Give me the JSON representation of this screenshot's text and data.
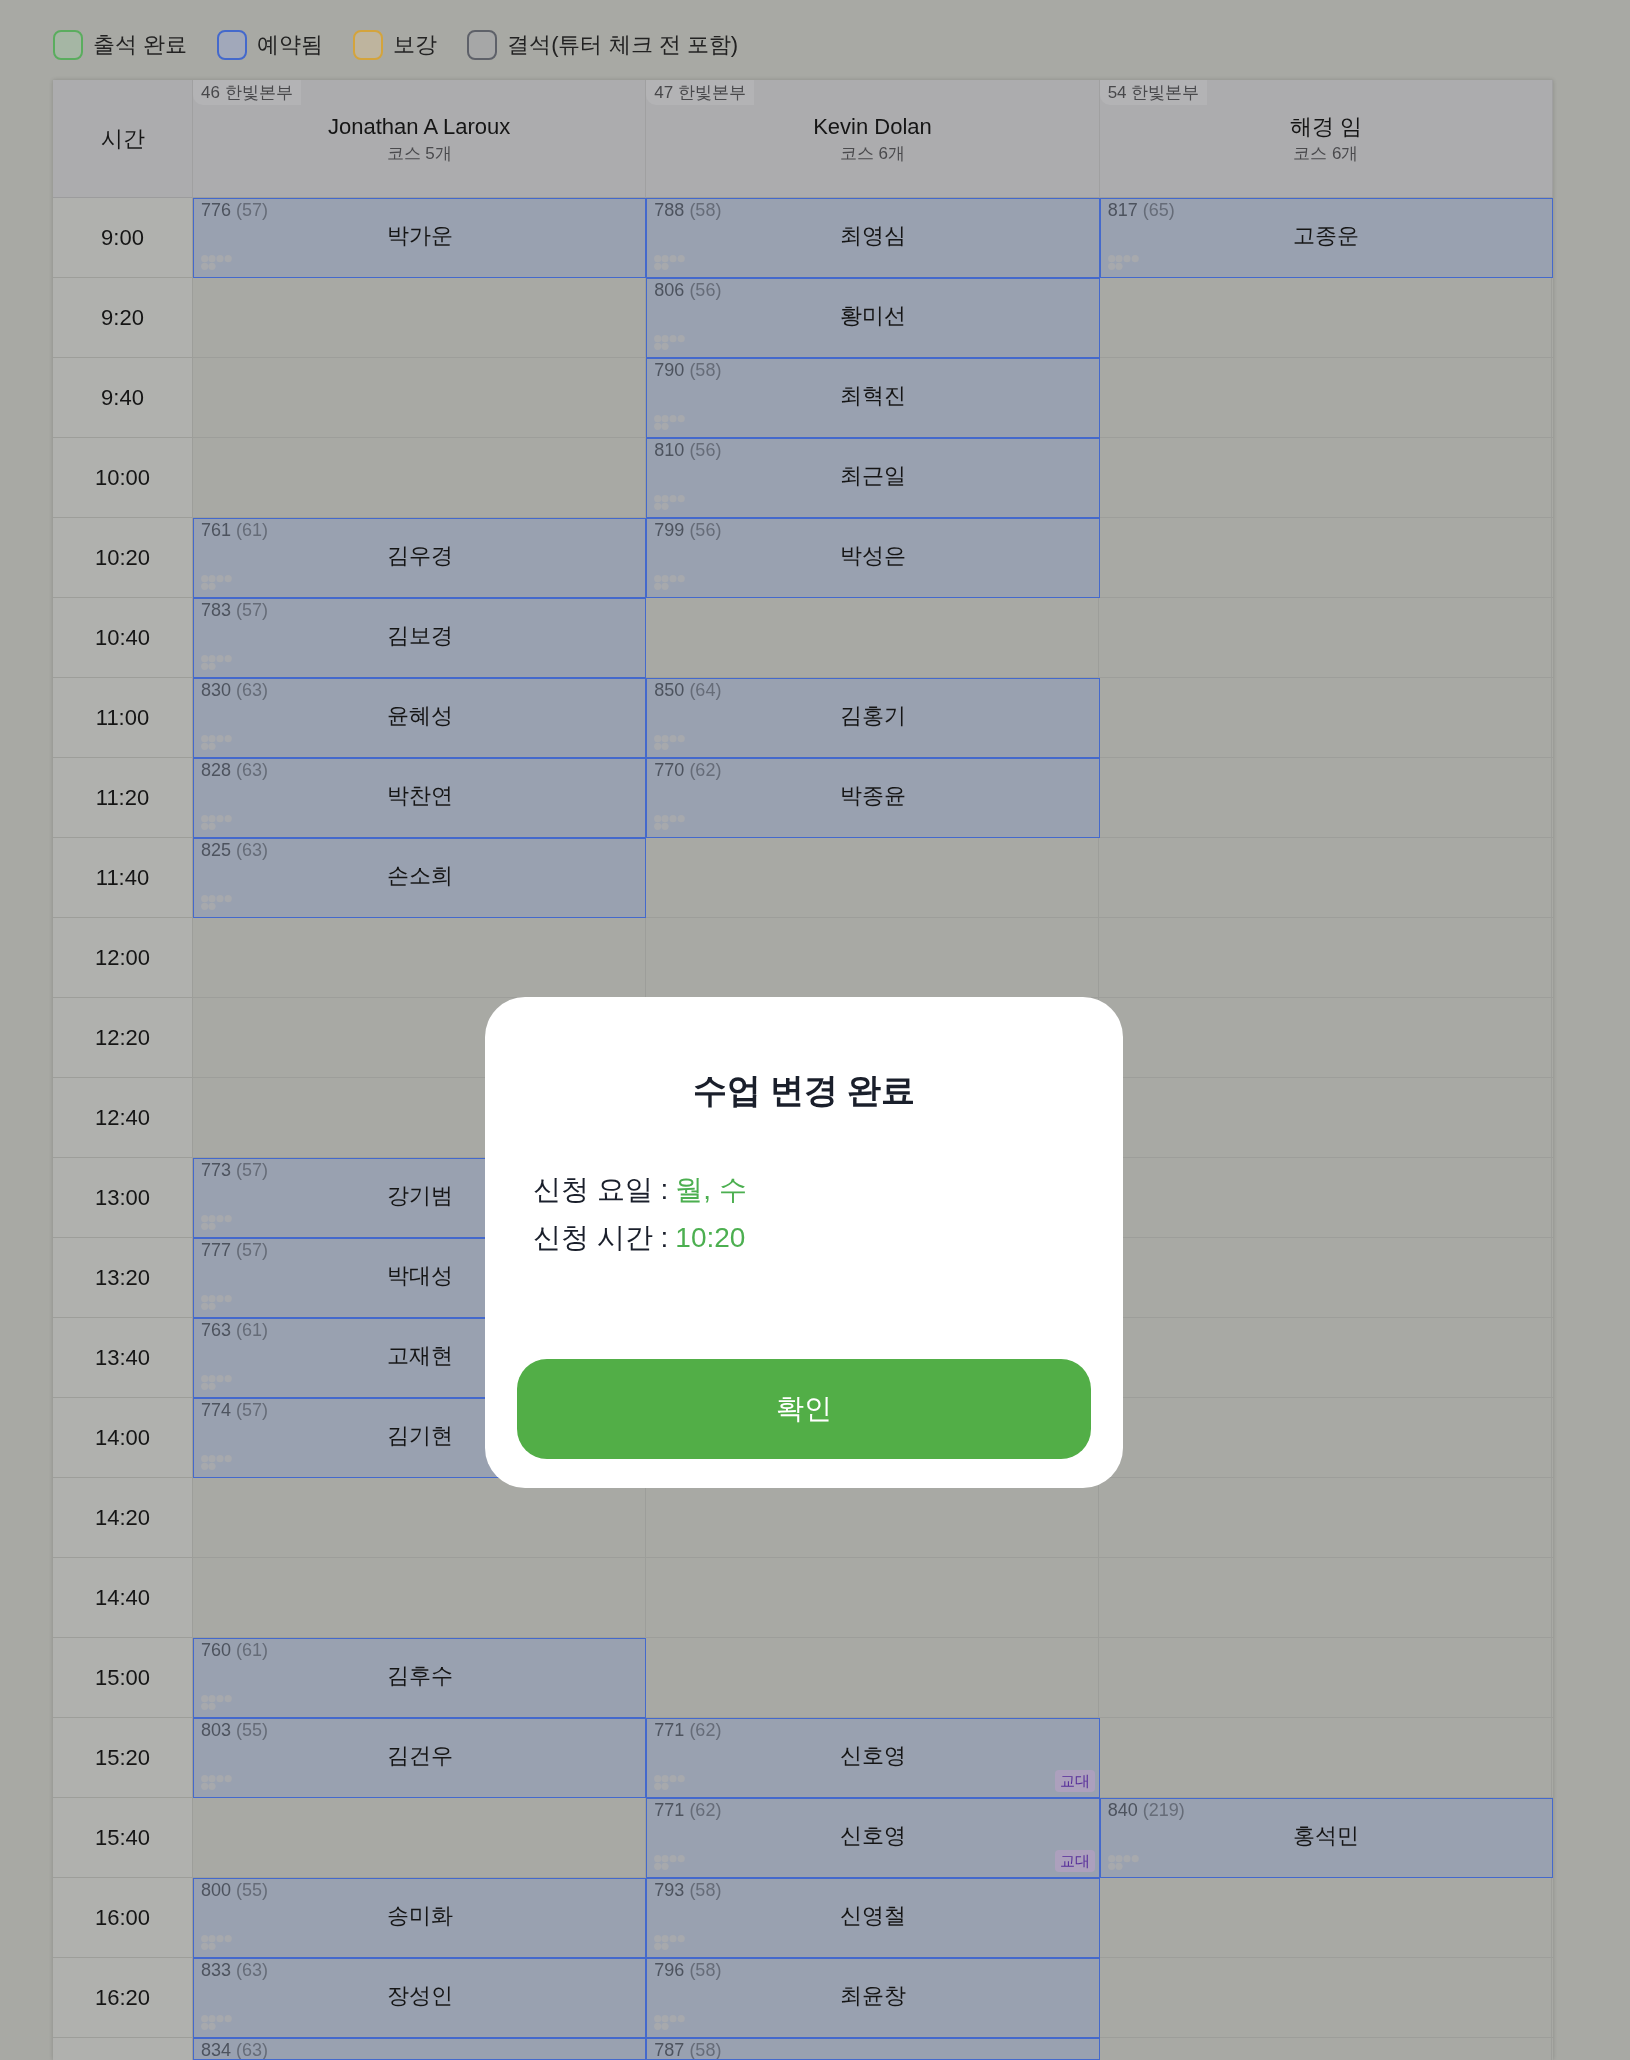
{
  "legend": [
    {
      "label": "출석 완료",
      "color": "#5aad5e"
    },
    {
      "label": "예약됨",
      "color": "#4469cc"
    },
    {
      "label": "보강",
      "color": "#d4a43c"
    },
    {
      "label": "결석(튜터 체크 전 포함)",
      "color": "#5e6169"
    }
  ],
  "schedule": {
    "time_heading": "시간",
    "tutors": [
      {
        "branch": "46 한빛본부",
        "name": "Jonathan A Laroux",
        "courses": "코스 5개"
      },
      {
        "branch": "47 한빛본부",
        "name": "Kevin Dolan",
        "courses": "코스 6개"
      },
      {
        "branch": "54 한빛본부",
        "name": "해경 임",
        "courses": "코스 6개"
      }
    ],
    "rows": [
      {
        "time": "9:00",
        "cells": [
          {
            "color": "#4469cc",
            "id": "776",
            "count": "(57)",
            "student": "박가운"
          },
          {
            "color": "#4469cc",
            "id": "788",
            "count": "(58)",
            "student": "최영심"
          },
          {
            "color": "#4469cc",
            "id": "817",
            "count": "(65)",
            "student": "고종운"
          }
        ]
      },
      {
        "time": "9:20",
        "cells": [
          null,
          {
            "color": "#4469cc",
            "id": "806",
            "count": "(56)",
            "student": "황미선"
          },
          null
        ]
      },
      {
        "time": "9:40",
        "cells": [
          null,
          {
            "color": "#4469cc",
            "id": "790",
            "count": "(58)",
            "student": "최혁진"
          },
          null
        ]
      },
      {
        "time": "10:00",
        "cells": [
          null,
          {
            "color": "#4469cc",
            "id": "810",
            "count": "(56)",
            "student": "최근일"
          },
          null
        ]
      },
      {
        "time": "10:20",
        "cells": [
          {
            "color": "#4469cc",
            "id": "761",
            "count": "(61)",
            "student": "김우경"
          },
          {
            "color": "#4469cc",
            "id": "799",
            "count": "(56)",
            "student": "박성은"
          },
          null
        ]
      },
      {
        "time": "10:40",
        "cells": [
          {
            "color": "#4469cc",
            "id": "783",
            "count": "(57)",
            "student": "김보경"
          },
          null,
          null
        ]
      },
      {
        "time": "11:00",
        "cells": [
          {
            "color": "#4469cc",
            "id": "830",
            "count": "(63)",
            "student": "윤혜성"
          },
          {
            "color": "#4469cc",
            "id": "850",
            "count": "(64)",
            "student": "김홍기"
          },
          null
        ]
      },
      {
        "time": "11:20",
        "cells": [
          {
            "color": "#4469cc",
            "id": "828",
            "count": "(63)",
            "student": "박찬연"
          },
          {
            "color": "#4469cc",
            "id": "770",
            "count": "(62)",
            "student": "박종윤"
          },
          null
        ]
      },
      {
        "time": "11:40",
        "cells": [
          {
            "color": "#4469cc",
            "id": "825",
            "count": "(63)",
            "student": "손소희"
          },
          null,
          null
        ]
      },
      {
        "time": "12:00",
        "cells": [
          null,
          null,
          null
        ]
      },
      {
        "time": "12:20",
        "cells": [
          null,
          null,
          null
        ]
      },
      {
        "time": "12:40",
        "cells": [
          null,
          null,
          null
        ]
      },
      {
        "time": "13:00",
        "cells": [
          {
            "color": "#4469cc",
            "id": "773",
            "count": "(57)",
            "student": "강기범"
          },
          null,
          null
        ]
      },
      {
        "time": "13:20",
        "cells": [
          {
            "color": "#4469cc",
            "id": "777",
            "count": "(57)",
            "student": "박대성"
          },
          null,
          null
        ]
      },
      {
        "time": "13:40",
        "cells": [
          {
            "color": "#4469cc",
            "id": "763",
            "count": "(61)",
            "student": "고재현"
          },
          null,
          null
        ]
      },
      {
        "time": "14:00",
        "cells": [
          {
            "color": "#4469cc",
            "id": "774",
            "count": "(57)",
            "student": "김기현"
          },
          null,
          null
        ]
      },
      {
        "time": "14:20",
        "cells": [
          null,
          null,
          null
        ]
      },
      {
        "time": "14:40",
        "cells": [
          null,
          null,
          null
        ]
      },
      {
        "time": "15:00",
        "cells": [
          {
            "color": "#4469cc",
            "id": "760",
            "count": "(61)",
            "student": "김후수"
          },
          null,
          null
        ]
      },
      {
        "time": "15:20",
        "cells": [
          {
            "color": "#4469cc",
            "id": "803",
            "count": "(55)",
            "student": "김건우"
          },
          {
            "color": "#4469cc",
            "id": "771",
            "count": "(62)",
            "student": "신호영",
            "badge": "교대"
          },
          null
        ]
      },
      {
        "time": "15:40",
        "cells": [
          null,
          {
            "color": "#4469cc",
            "id": "771",
            "count": "(62)",
            "student": "신호영",
            "badge": "교대"
          },
          {
            "color": "#4469cc",
            "id": "840",
            "count": "(219)",
            "student": "홍석민"
          }
        ]
      },
      {
        "time": "16:00",
        "cells": [
          {
            "color": "#4469cc",
            "id": "800",
            "count": "(55)",
            "student": "송미화"
          },
          {
            "color": "#4469cc",
            "id": "793",
            "count": "(58)",
            "student": "신영철"
          },
          null
        ]
      },
      {
        "time": "16:20",
        "cells": [
          {
            "color": "#4469cc",
            "id": "833",
            "count": "(63)",
            "student": "장성인"
          },
          {
            "color": "#4469cc",
            "id": "796",
            "count": "(58)",
            "student": "최윤창"
          },
          null
        ]
      },
      {
        "cells": [
          {
            "color": "#4469cc",
            "id": "834",
            "count": "(63)"
          },
          {
            "color": "#4469cc",
            "id": "787",
            "count": "(58)"
          },
          null
        ]
      }
    ]
  },
  "dialog": {
    "title": "수업 변경 완료",
    "fields": [
      {
        "label": "신청 요일 :",
        "value": "월, 수"
      },
      {
        "label": "신청 시간 :",
        "value": "10:20"
      }
    ],
    "button": "확인"
  }
}
